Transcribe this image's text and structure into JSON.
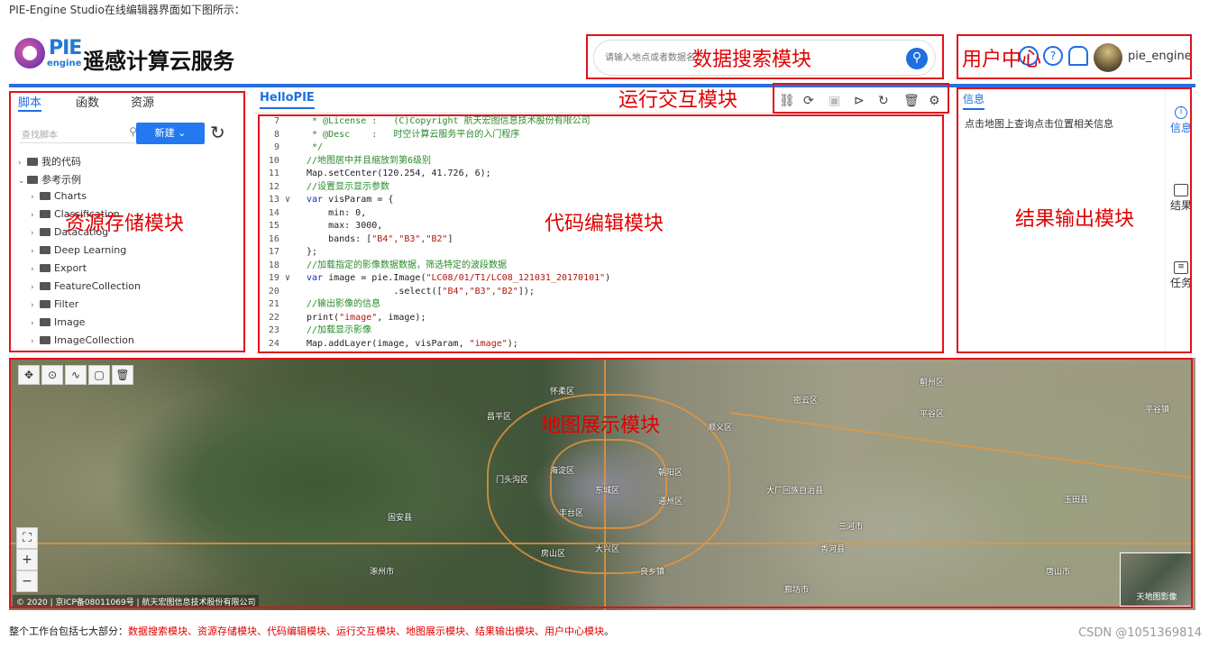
{
  "caption_top": "PIE-Engine Studio在线编辑器界面如下图所示：",
  "header": {
    "logo_pie": "PIE",
    "logo_engine": "engine",
    "title": "遥感计算云服务",
    "search_placeholder": "请输入地点或者数据名",
    "user": "pie_engine"
  },
  "overlay_labels": {
    "search": "数据搜索模块",
    "user": "用户中心",
    "run": "运行交互模块",
    "resource": "资源存储模块",
    "code": "代码编辑模块",
    "output": "结果输出模块",
    "map": "地图展示模块"
  },
  "left_panel": {
    "tabs": [
      "脚本",
      "函数",
      "资源"
    ],
    "search_placeholder": "查找脚本",
    "new_button": "新建",
    "tree": [
      {
        "label": "我的代码",
        "level": 0,
        "caret": "›"
      },
      {
        "label": "参考示例",
        "level": 0,
        "caret": "⌄"
      },
      {
        "label": "Charts",
        "level": 1,
        "caret": "›"
      },
      {
        "label": "Classification",
        "level": 1,
        "caret": "›"
      },
      {
        "label": "Datacatlog",
        "level": 1,
        "caret": "›"
      },
      {
        "label": "Deep Learning",
        "level": 1,
        "caret": "›"
      },
      {
        "label": "Export",
        "level": 1,
        "caret": "›"
      },
      {
        "label": "FeatureCollection",
        "level": 1,
        "caret": "›"
      },
      {
        "label": "Filter",
        "level": 1,
        "caret": "›"
      },
      {
        "label": "Image",
        "level": 1,
        "caret": "›"
      },
      {
        "label": "ImageCollection",
        "level": 1,
        "caret": "›"
      }
    ]
  },
  "code_panel": {
    "tab": "HelloPIE",
    "lines": [
      {
        "n": "7",
        "f": "",
        "segs": [
          {
            "t": " * @License :   (C)Copyright 航天宏图信息技术股份有限公司",
            "c": "c-comment"
          }
        ]
      },
      {
        "n": "8",
        "f": "",
        "segs": [
          {
            "t": " * @Desc    :   时空计算云服务平台的入门程序",
            "c": "c-comment"
          }
        ]
      },
      {
        "n": "9",
        "f": "",
        "segs": [
          {
            "t": " */",
            "c": "c-comment"
          }
        ]
      },
      {
        "n": "10",
        "f": "",
        "segs": [
          {
            "t": "//地图居中并且缩放到第6级别",
            "c": "c-comment"
          }
        ]
      },
      {
        "n": "11",
        "f": "",
        "segs": [
          {
            "t": "Map.setCenter(120.254, 41.726, 6);",
            "c": "c-plain"
          }
        ]
      },
      {
        "n": "12",
        "f": "",
        "segs": [
          {
            "t": "//设置显示显示参数",
            "c": "c-comment"
          }
        ]
      },
      {
        "n": "13",
        "f": "∨",
        "segs": [
          {
            "t": "var ",
            "c": "c-kw"
          },
          {
            "t": "visParam = {",
            "c": "c-plain"
          }
        ]
      },
      {
        "n": "14",
        "f": "",
        "segs": [
          {
            "t": "    min: 0,",
            "c": "c-plain"
          }
        ]
      },
      {
        "n": "15",
        "f": "",
        "segs": [
          {
            "t": "    max: 3000,",
            "c": "c-plain"
          }
        ]
      },
      {
        "n": "16",
        "f": "",
        "segs": [
          {
            "t": "    bands: [",
            "c": "c-plain"
          },
          {
            "t": "\"B4\",\"B3\",\"B2\"",
            "c": "c-str"
          },
          {
            "t": "]",
            "c": "c-plain"
          }
        ]
      },
      {
        "n": "17",
        "f": "",
        "segs": [
          {
            "t": "};",
            "c": "c-plain"
          }
        ]
      },
      {
        "n": "18",
        "f": "",
        "segs": [
          {
            "t": "//加载指定的影像数据数据，筛选特定的波段数据",
            "c": "c-comment"
          }
        ]
      },
      {
        "n": "19",
        "f": "∨",
        "segs": [
          {
            "t": "var ",
            "c": "c-kw"
          },
          {
            "t": "image = pie.Image(",
            "c": "c-plain"
          },
          {
            "t": "\"LC08/01/T1/LC08_121031_20170101\"",
            "c": "c-str"
          },
          {
            "t": ")",
            "c": "c-plain"
          }
        ]
      },
      {
        "n": "20",
        "f": "",
        "segs": [
          {
            "t": "                .select([",
            "c": "c-plain"
          },
          {
            "t": "\"B4\",\"B3\",\"B2\"",
            "c": "c-str"
          },
          {
            "t": "]);",
            "c": "c-plain"
          }
        ]
      },
      {
        "n": "21",
        "f": "",
        "segs": [
          {
            "t": "//输出影像的信息",
            "c": "c-comment"
          }
        ]
      },
      {
        "n": "22",
        "f": "",
        "segs": [
          {
            "t": "print(",
            "c": "c-plain"
          },
          {
            "t": "\"image\"",
            "c": "c-str"
          },
          {
            "t": ", image);",
            "c": "c-plain"
          }
        ]
      },
      {
        "n": "23",
        "f": "",
        "segs": [
          {
            "t": "//加载显示影像",
            "c": "c-comment"
          }
        ]
      },
      {
        "n": "24",
        "f": "",
        "segs": [
          {
            "t": "Map.addLayer(image, visParam, ",
            "c": "c-plain"
          },
          {
            "t": "\"image\"",
            "c": "c-str"
          },
          {
            "t": ");",
            "c": "c-plain"
          }
        ]
      }
    ]
  },
  "info_panel": {
    "tab": "信息",
    "text": "点击地图上查询点击位置相关信息",
    "side_tabs": [
      "信息",
      "结果",
      "任务"
    ]
  },
  "map": {
    "copyright": "© 2020 | 京ICP备08011069号 | 航天宏图信息技术股份有限公司",
    "minimap_label": "天地图影像",
    "places": [
      "门头沟区",
      "海淀区",
      "东城区",
      "朝阳区",
      "通州区",
      "丰台区",
      "大兴区",
      "房山区",
      "昌平区",
      "顺义区",
      "怀柔区",
      "密云区",
      "平谷区",
      "三河市",
      "大厂回族自治县",
      "香河县",
      "涿州市",
      "固安县",
      "廊坊市",
      "唐山市",
      "玉田县",
      "蓟州区",
      "良乡镇",
      "平谷镇"
    ]
  },
  "footer": {
    "text_prefix": "整个工作台包括七大部分：",
    "text_red": "数据搜索模块、资源存储模块、代码编辑模块、运行交互模块、地图展示模块、结果输出模块、用户中心模块",
    "text_suffix": "。",
    "watermark": "CSDN @1051369814"
  }
}
